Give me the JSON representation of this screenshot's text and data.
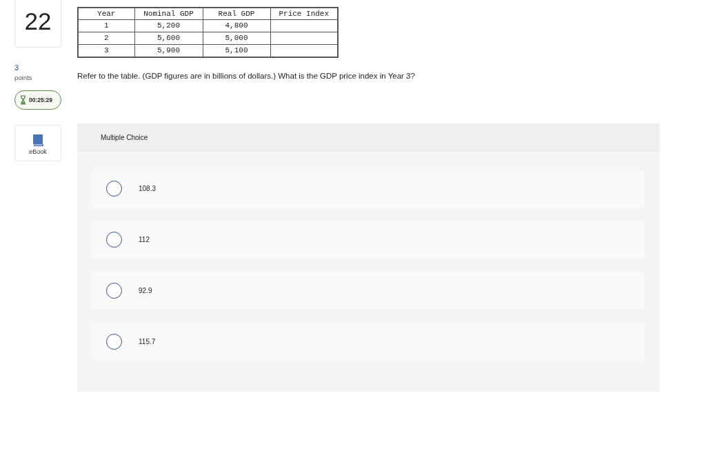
{
  "question_number": "22",
  "points": {
    "value": "3",
    "label": "points"
  },
  "timer": {
    "time": "00:25:29"
  },
  "ebook": {
    "label": "eBook"
  },
  "table": {
    "columns": [
      "Year",
      "Nominal GDP",
      "Real GDP",
      "Price Index"
    ],
    "rows": [
      [
        "1",
        "5,200",
        "4,800"
      ],
      [
        "2",
        "5,600",
        "5,000"
      ],
      [
        "3",
        "5,900",
        "5,100"
      ]
    ]
  },
  "question_text": "Refer to the table. (GDP figures are in billions of dollars.) What is the GDP price index in Year 3?",
  "answer_panel": {
    "title": "Multiple Choice",
    "options": [
      {
        "label": "108.3",
        "selected": false
      },
      {
        "label": "112",
        "selected": false
      },
      {
        "label": "92.9",
        "selected": false
      },
      {
        "label": "115.7",
        "selected": false
      }
    ]
  }
}
